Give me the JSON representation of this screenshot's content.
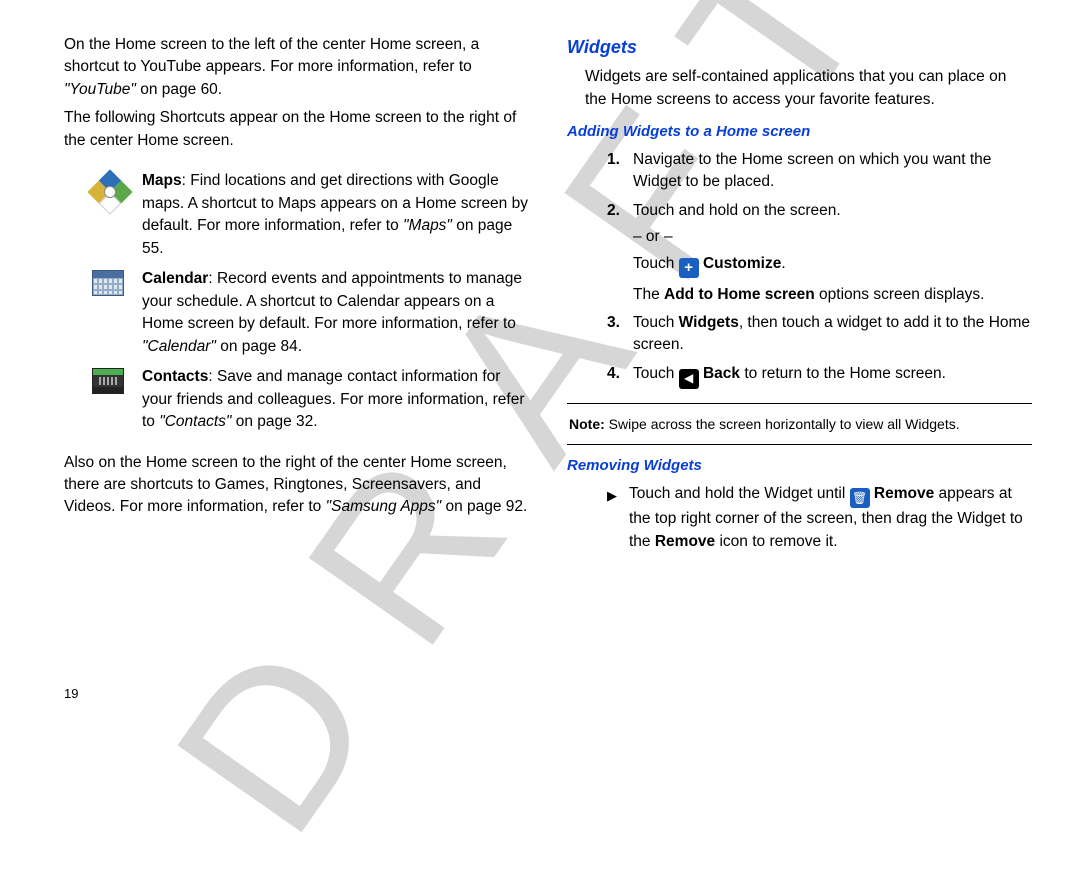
{
  "watermark": "DRAFT",
  "page_number": "19",
  "left": {
    "intro1a": "On the Home screen to the left of the center Home screen, a shortcut to YouTube appears. For more information, refer to ",
    "intro1_ref": "\"YouTube\"",
    "intro1b": " on page 60.",
    "intro2": "The following Shortcuts appear on the Home screen to the right of the center Home screen.",
    "maps_bold": "Maps",
    "maps_text": ": Find locations and get directions with Google maps. A shortcut to Maps appears on a Home screen by default. For more information, refer to ",
    "maps_ref": "\"Maps\"",
    "maps_tail": " on page 55.",
    "cal_bold": "Calendar",
    "cal_text": ": Record events and appointments to manage your schedule. A shortcut to Calendar appears on a Home screen by default. For more information, refer to ",
    "cal_ref": "\"Calendar\"",
    "cal_tail": " on page 84.",
    "con_bold": "Contacts",
    "con_text": ": Save and manage contact information for your friends and colleagues. For more information, refer to ",
    "con_ref": "\"Contacts\"",
    "con_tail": " on page 32.",
    "outro_a": "Also on the Home screen to the right of the center Home screen, there are shortcuts to Games, Ringtones, Screensavers, and Videos. For more information, refer to ",
    "outro_ref": "\"Samsung Apps\"",
    "outro_b": " on page 92."
  },
  "right": {
    "h_widgets": "Widgets",
    "widgets_intro": "Widgets are self-contained applications that you can place on the Home screens to access your favorite features.",
    "h_adding": "Adding Widgets to a Home screen",
    "step1_num": "1.",
    "step1": "Navigate to the Home screen on which you want the Widget to be placed.",
    "step2_num": "2.",
    "step2_a": "Touch and hold on the screen.",
    "step2_or": "– or –",
    "step2_touch": "Touch ",
    "step2_customize": "Customize",
    "step2_period": ".",
    "step2_result_a": "The ",
    "step2_result_b": "Add to Home screen",
    "step2_result_c": " options screen displays.",
    "step3_num": "3.",
    "step3_a": "Touch ",
    "step3_b": "Widgets",
    "step3_c": ", then touch a widget to add it to the Home screen.",
    "step4_num": "4.",
    "step4_a": "Touch ",
    "step4_back": "Back",
    "step4_b": " to return to the Home screen.",
    "note_label": "Note:",
    "note_text": " Swipe across the screen horizontally to view all Widgets.",
    "h_removing": "Removing Widgets",
    "remove_a": "Touch and hold the Widget until ",
    "remove_b": "Remove",
    "remove_c": " appears at the top right corner of the screen, then drag the Widget to the ",
    "remove_d": "Remove",
    "remove_e": " icon to remove it."
  }
}
